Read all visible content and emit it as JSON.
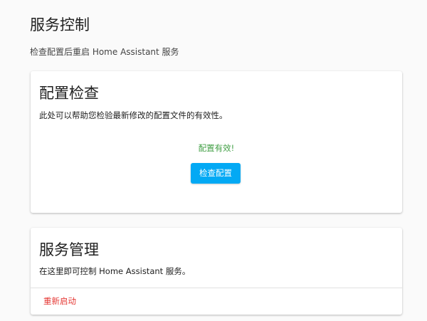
{
  "page": {
    "title": "服务控制",
    "subtitle": "检查配置后重启 Home Assistant 服务"
  },
  "config_card": {
    "heading": "配置检查",
    "description": "此处可以帮助您检验最新修改的配置文件的有效性。",
    "status": "配置有效!",
    "check_button_label": "检查配置"
  },
  "service_card": {
    "heading": "服务管理",
    "description": "在这里即可控制 Home Assistant 服务。",
    "restart_button_label": "重新启动"
  },
  "colors": {
    "background": "#fafafa",
    "card": "#ffffff",
    "primary": "#03a9f4",
    "success": "#43a047",
    "danger": "#e53935"
  }
}
